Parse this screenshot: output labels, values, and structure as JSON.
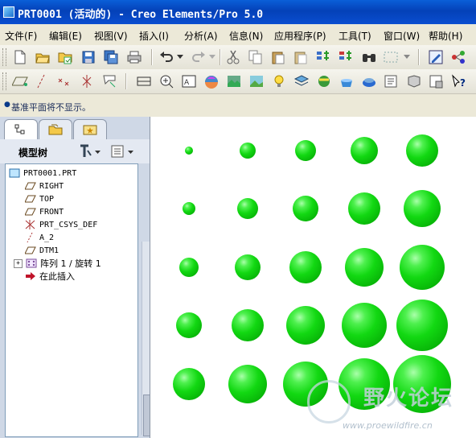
{
  "window": {
    "title": "PRT0001 (活动的) - Creo Elements/Pro 5.0"
  },
  "menubar": [
    {
      "label": "文件(F)"
    },
    {
      "label": "编辑(E)"
    },
    {
      "label": "视图(V)"
    },
    {
      "label": "插入(I)"
    },
    {
      "label": "分析(A)"
    },
    {
      "label": "信息(N)"
    },
    {
      "label": "应用程序(P)"
    },
    {
      "label": "工具(T)"
    },
    {
      "label": "窗口(W)"
    },
    {
      "label": "帮助(H)"
    }
  ],
  "toolbar1": [
    "new-file-icon",
    "open-file-icon",
    "open-folder-icon",
    "save-icon",
    "save-copy-icon",
    "print-icon",
    "undo-icon",
    "undo-dropdown-icon",
    "redo-icon",
    "redo-dropdown-icon",
    "cut-icon",
    "copy-icon",
    "paste-icon",
    "paste-special-icon",
    "regenerate-icon",
    "regenerate-manager-icon",
    "find-icon",
    "selection-box-icon",
    "select-dropdown-icon",
    "edit-definition-icon",
    "relations-icon"
  ],
  "toolbar2": [
    "datum-plane-display-icon",
    "datum-axis-display-icon",
    "datum-point-display-icon",
    "coord-sys-display-icon",
    "annotation-display-icon",
    "refit-icon",
    "zoom-in-icon",
    "zoom-out-icon",
    "repaint-icon",
    "spin-center-icon",
    "orient-icon",
    "saved-views-icon",
    "layers-icon",
    "lighting-icon",
    "appearance-icon",
    "model-tree-toggle-icon",
    "render-icon",
    "whats-this-icon"
  ],
  "status": {
    "message": "基准平面将不显示。"
  },
  "left_panel": {
    "tabs": [
      "model-tree-tab",
      "folder-browser-tab",
      "favorites-tab"
    ],
    "title": "模型树",
    "tree": [
      {
        "label": "PRT0001.PRT",
        "icon": "part-icon"
      },
      {
        "label": "RIGHT",
        "icon": "datum-plane-icon"
      },
      {
        "label": "TOP",
        "icon": "datum-plane-icon"
      },
      {
        "label": "FRONT",
        "icon": "datum-plane-icon"
      },
      {
        "label": "PRT_CSYS_DEF",
        "icon": "csys-icon"
      },
      {
        "label": "A_2",
        "icon": "datum-axis-icon"
      },
      {
        "label": "DTM1",
        "icon": "datum-plane-icon"
      },
      {
        "label": "阵列 1 / 旋转 1",
        "icon": "pattern-icon",
        "expandable": true
      },
      {
        "label": "在此插入",
        "icon": "insert-here-icon"
      }
    ]
  },
  "model": {
    "grid_rows": 5,
    "grid_cols": 5,
    "sphere_color": "#18d418"
  },
  "watermark": {
    "brand": "野火论坛",
    "url": "www.proewildfire.cn"
  }
}
